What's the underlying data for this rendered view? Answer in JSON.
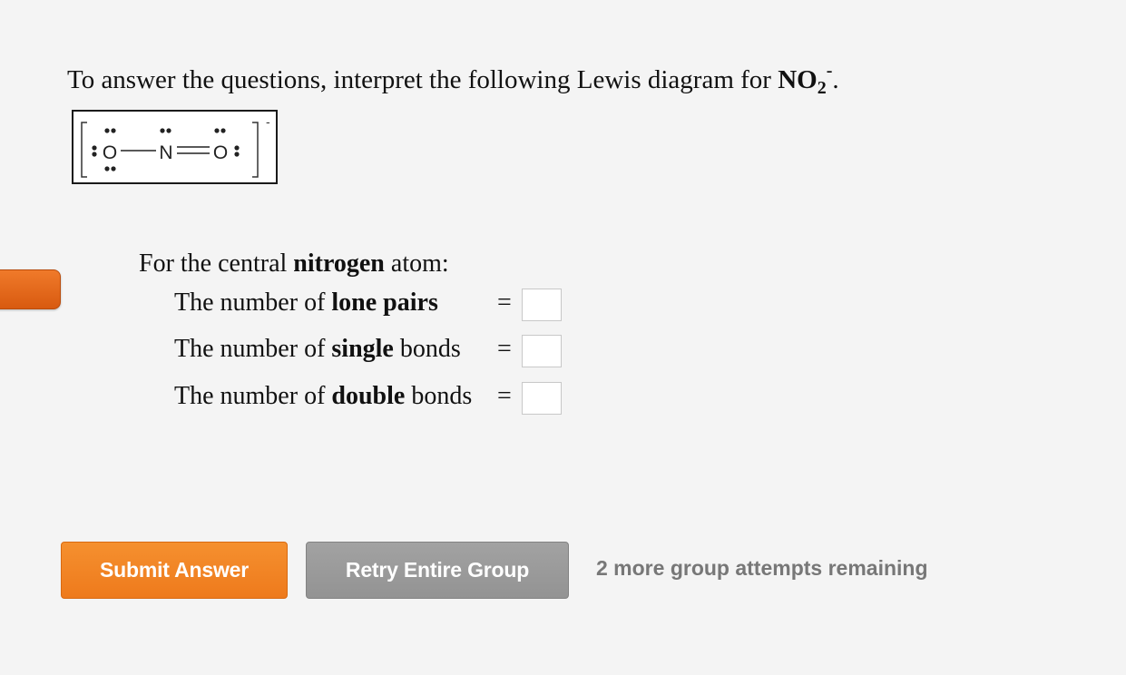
{
  "intro": {
    "text": "To answer the questions, interpret the following Lewis diagram for ",
    "formula_main": "NO",
    "formula_sub": "2",
    "formula_charge": "-",
    "end": "."
  },
  "lewis": {
    "atom_left": "O",
    "atom_center": "N",
    "atom_right": "O",
    "charge": "-"
  },
  "question": {
    "head_pre": "For the central ",
    "head_bold": "nitrogen",
    "head_post": " atom:",
    "rows": [
      {
        "pre": "The number of ",
        "bold": "lone pairs",
        "post": "",
        "eq": "=",
        "value": ""
      },
      {
        "pre": "The number of ",
        "bold": "single",
        "post": " bonds",
        "eq": "=",
        "value": ""
      },
      {
        "pre": "The number of ",
        "bold": "double",
        "post": " bonds",
        "eq": "=",
        "value": ""
      }
    ]
  },
  "buttons": {
    "submit": "Submit Answer",
    "retry": "Retry Entire Group"
  },
  "attempts_text": "2 more group attempts remaining",
  "colors": {
    "submit": "#f08524",
    "retry": "#999999",
    "side_tab": "#e4691b",
    "attempts_text": "#777777"
  }
}
